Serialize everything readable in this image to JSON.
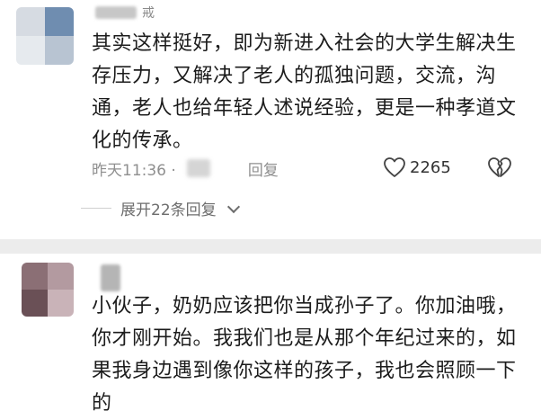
{
  "comments": [
    {
      "username_tail": "戒",
      "text": "其实这样挺好，即为新进入社会的大学生解决生存压力，又解决了老人的孤独问题，交流，沟通，老人也给年轻人述说经验，更是一种孝道文化的传承。",
      "time": "昨天11:36 ·",
      "reply_label": "回复",
      "like_count": "2265",
      "expand_label": "展开22条回复"
    },
    {
      "text": "小伙子，奶奶应该把你当成孙子了。你加油哦，你才刚开始。我我们也是从那个年纪过来的，如果我身边遇到像你这样的孩子，我也会照顾一下的"
    }
  ],
  "icons": {
    "like": "heart-outline-icon",
    "dislike": "broken-heart-icon",
    "expand": "chevron-down-icon"
  },
  "colors": {
    "text": "#1c1c1c",
    "meta": "#8f8f8f",
    "divider": "#ececec"
  }
}
